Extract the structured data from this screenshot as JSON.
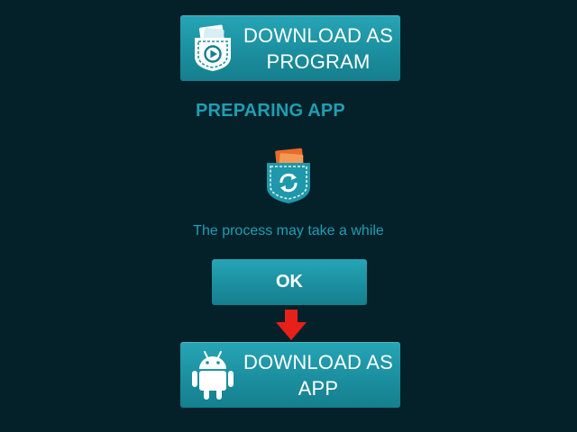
{
  "buttons": {
    "download_program": {
      "line1": "DOWNLOAD AS",
      "line2": "PROGRAM",
      "icon": "pocket-play-icon"
    },
    "download_app": {
      "line1": "DOWNLOAD AS",
      "line2": "APP",
      "icon": "android-icon"
    },
    "ok": {
      "label": "OK"
    }
  },
  "status": {
    "heading": "PREPARING APP",
    "message": "The process may take a while",
    "icon": "pocket-sync-icon"
  },
  "indicator": {
    "icon": "red-down-arrow-icon",
    "color": "#e8201a"
  },
  "colors": {
    "background": "#04212a",
    "accent": "#1f9eb2",
    "button": "#1b8f9f",
    "pocket_orange": "#e86a2a"
  }
}
